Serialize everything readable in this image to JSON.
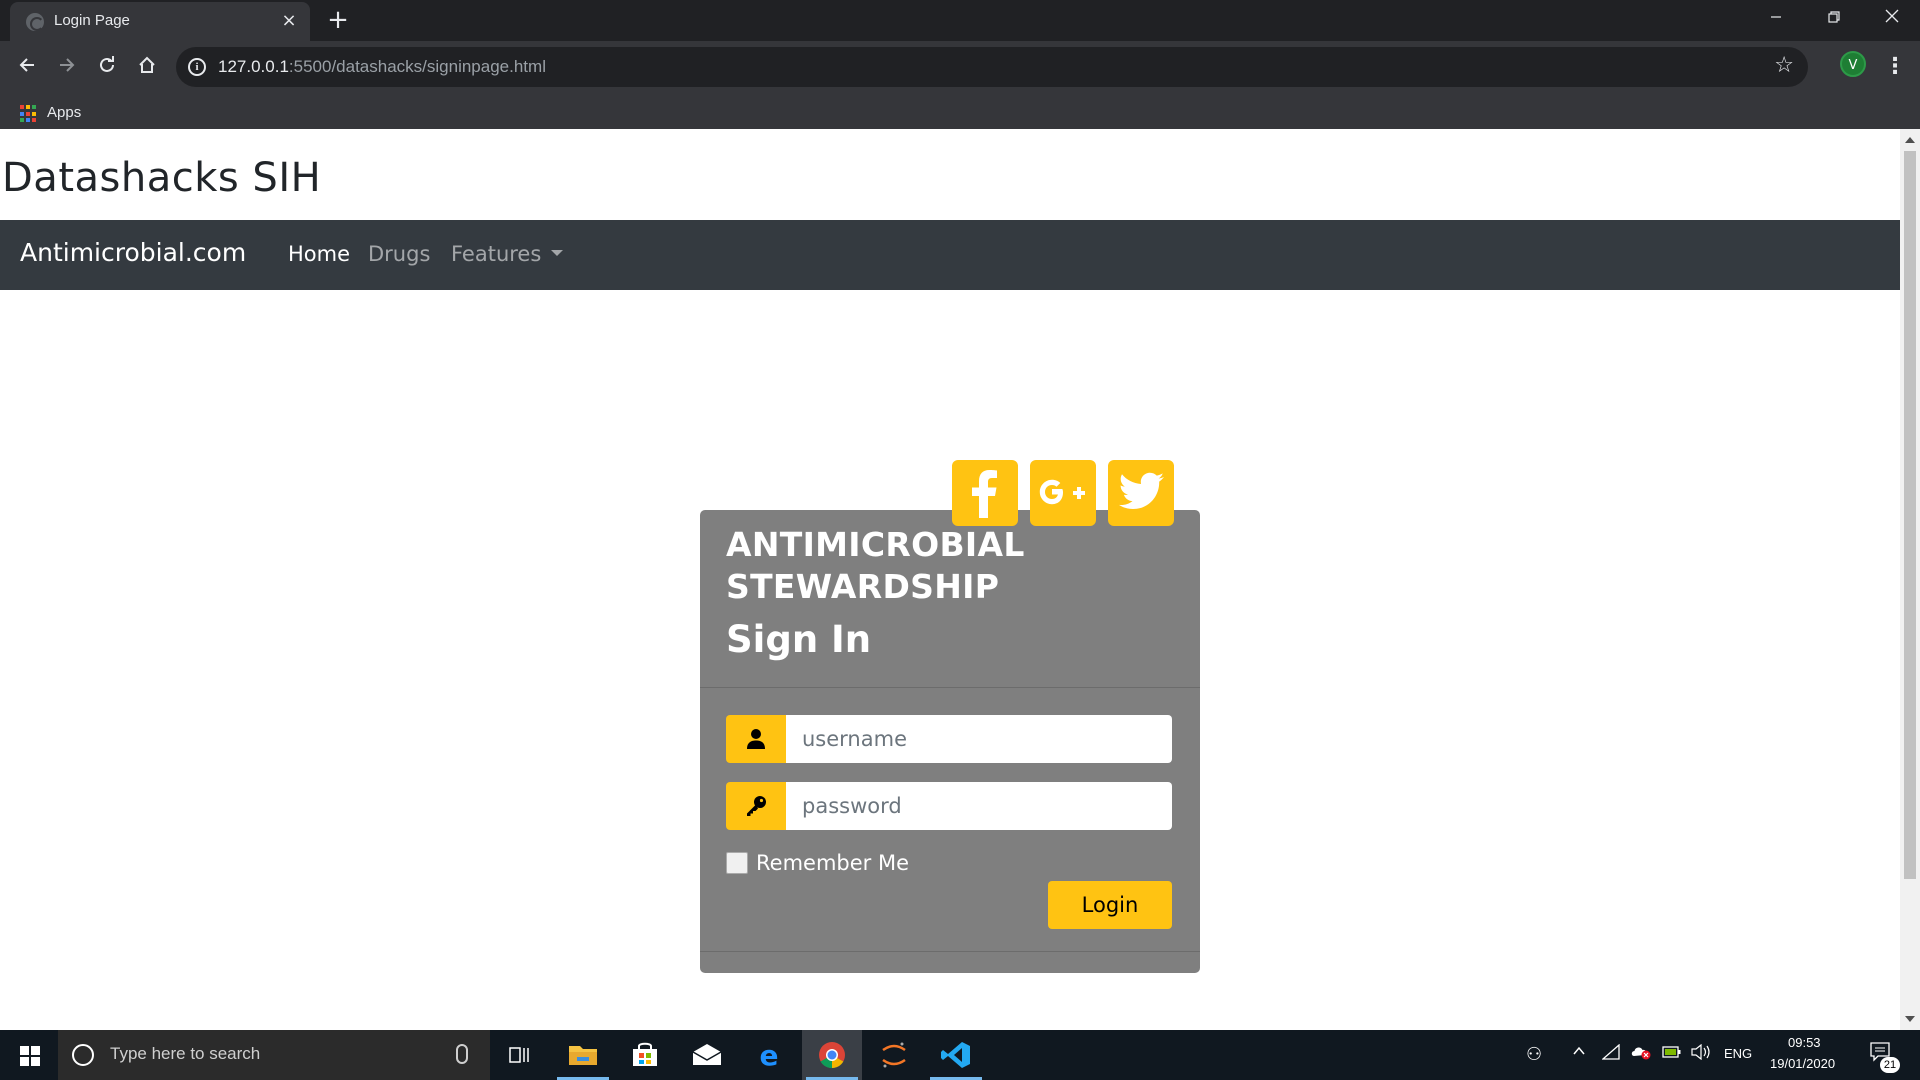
{
  "browser": {
    "tab_title": "Login Page",
    "tab_close": "×",
    "new_tab": "+",
    "url_host": "127.0.0.1",
    "url_rest": ":5500/datashacks/signinpage.html",
    "profile_initial": "V",
    "bookmarks_apps": "Apps",
    "icons": [
      "back-icon",
      "forward-icon",
      "reload-icon",
      "home-icon",
      "info-icon",
      "star-icon",
      "menu-icon"
    ]
  },
  "page": {
    "site_title": "Datashacks SIH",
    "navbar": {
      "brand": "Antimicrobial.com",
      "links": [
        {
          "label": "Home",
          "active": true
        },
        {
          "label": "Drugs",
          "active": false
        },
        {
          "label": "Features",
          "active": false,
          "dropdown": true
        }
      ],
      "background": "#343a40"
    },
    "login": {
      "title": "ANTIMICROBIAL STEWARDSHIP",
      "subtitle": "Sign In",
      "social": [
        "facebook-icon",
        "google-plus-icon",
        "twitter-icon"
      ],
      "username_placeholder": "username",
      "password_placeholder": "password",
      "remember_label": "Remember Me",
      "remember_checked": false,
      "login_button": "Login",
      "accent": "#ffc312"
    }
  },
  "taskbar": {
    "search_placeholder": "Type here to search",
    "lang": "ENG",
    "time": "09:53",
    "date": "19/01/2020",
    "notifications": "21",
    "pinned": [
      "task-view-icon",
      "file-explorer-icon",
      "store-icon",
      "mail-icon",
      "edge-icon",
      "chrome-icon",
      "jupyter-icon",
      "vscode-icon"
    ]
  }
}
